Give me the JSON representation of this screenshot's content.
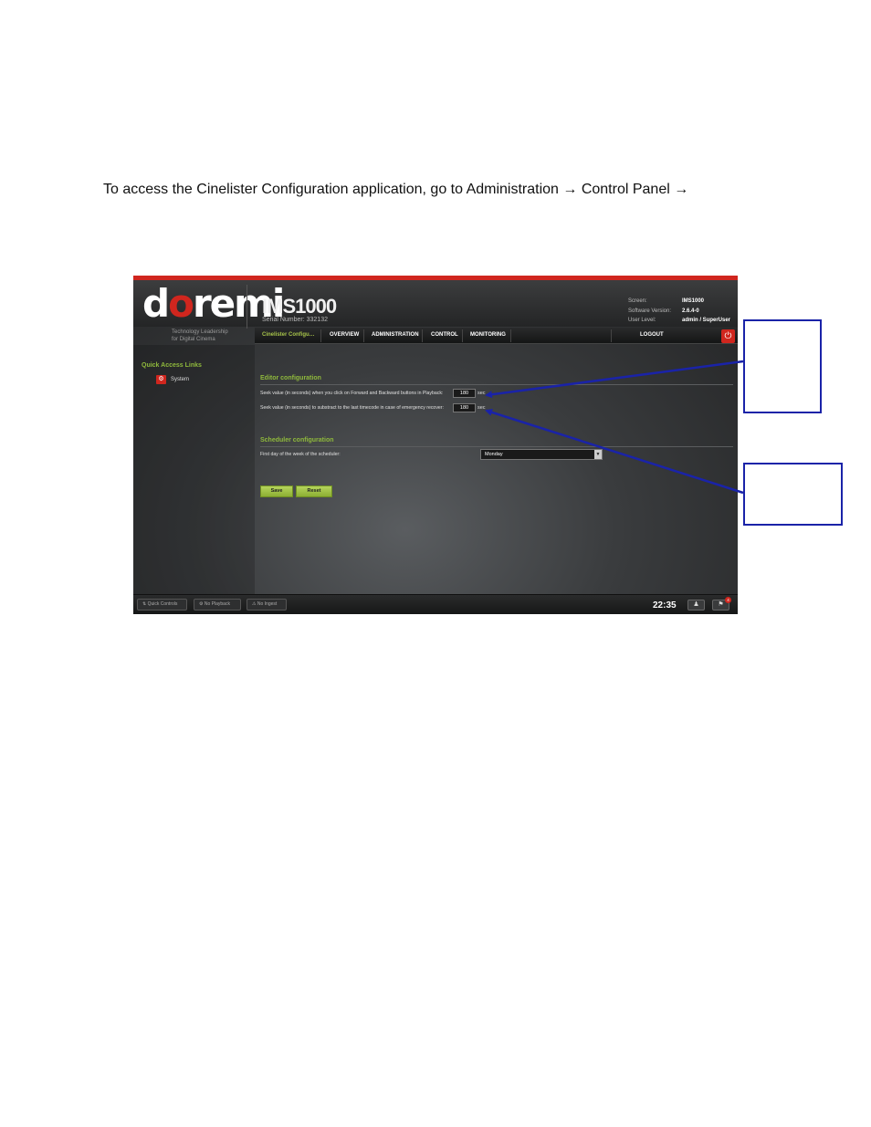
{
  "instructions": "To access the Cinelister Configuration application, go to Administration → Control Panel →",
  "app": {
    "logo": "doremi",
    "tagline_line1": "Technology Leadership",
    "tagline_line2": "for Digital Cinema",
    "model": "IMS1000",
    "serial": "Serial Number: 332132",
    "info_labels": [
      "Screen:",
      "Software Version:",
      "User Level:"
    ],
    "info_values": [
      "IMS1000",
      "2.6.4-0",
      "admin / SuperUser"
    ],
    "nav": {
      "current": "Cinelister Configu…",
      "overview": "OVERVIEW",
      "administration": "ADMINISTRATION",
      "control": "CONTROL",
      "monitoring": "MONITORING",
      "logout": "LOGOUT"
    },
    "sidebar": {
      "title": "Quick Access Links",
      "system": "System"
    },
    "editor": {
      "title": "Editor configuration",
      "seek_forward_label": "Seek value (in seconds) when you click on Forward and Backward buttons in Playback:",
      "seek_forward_value": "180",
      "seek_recover_label": "Seek value (in seconds) to substract to the last timecode in case of emergency recover:",
      "seek_recover_value": "180",
      "unit": "sec"
    },
    "scheduler": {
      "title": "Scheduler configuration",
      "first_day_label": "First day of the week of the scheduler:",
      "first_day_value": "Monday"
    },
    "buttons": {
      "save": "Save",
      "reset": "Reset"
    },
    "footer": {
      "quick_controls": "Quick Controls",
      "no_playback": "No Playback",
      "no_ingest": "No Ingest",
      "time": "22:35",
      "badge": "4"
    }
  },
  "colors": {
    "accent_red": "#d0261e",
    "accent_green": "#8fb93c",
    "callout_blue": "#1a23a8"
  }
}
